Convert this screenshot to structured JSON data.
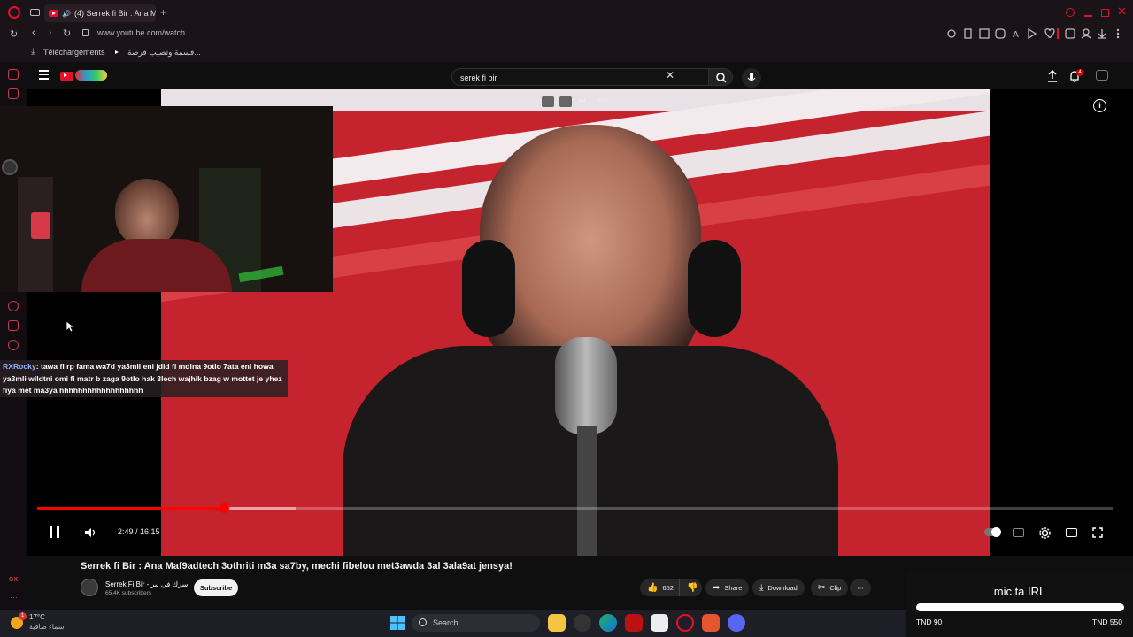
{
  "browser": {
    "tab_title": "(4) Serrek fi Bir : Ana M",
    "url": "www.youtube.com/watch",
    "bookmarks": [
      "Téléchargements",
      "قسمة وتصيب فرصة..."
    ],
    "new_tab_glyph": "+"
  },
  "youtube": {
    "search_query": "serek fi bir",
    "notification_count": "4",
    "player_buttons": [
      "RGX"
    ],
    "time_display": "2:49 / 16:15",
    "progress": 0.174,
    "buffered": 0.24,
    "video_title": "Serrek fi Bir : Ana Maf9adtech 3othriti m3a sa7by, mechi fibelou met3awda 3al 3ala9at jensya!",
    "channel_name": "Serrek Fi Bir - سرك في بير",
    "subscribers": "65.4K subscribers",
    "subscribe_label": "Subscribe",
    "likes": "652",
    "share_label": "Share",
    "download_label": "Download",
    "clip_label": "Clip"
  },
  "stream_overlay": {
    "chat_user": "RXRocky",
    "chat_message": ": tawa fi rp fama wa7d ya3mli eni jdid fi mdina 9otlo 7ata eni howa ya3mli wildtni omi fi matr b zaga 9otlo hak 3lech wajhik bzag w mottet je yhez fiya met ma3ya hhhhhhhhhhhhhhhhhh",
    "goal_title": "mic ta IRL",
    "goal_min": "TND 90",
    "goal_max": "TND 550",
    "goal_progress": 1.0
  },
  "taskbar": {
    "weather_temp": "17°C",
    "weather_desc": "سماء صافية",
    "weather_badge": "1",
    "search_placeholder": "Search"
  },
  "colors": {
    "accent": "#ff0000",
    "opera_red": "#e5102a",
    "studio_red": "#c5232d"
  }
}
